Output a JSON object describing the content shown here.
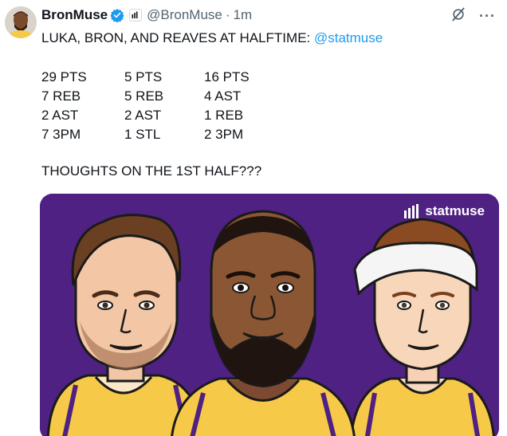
{
  "author": {
    "display_name": "BronMuse",
    "handle": "@BronMuse",
    "separator": "·",
    "time": "1m"
  },
  "tweet": {
    "text": "LUKA, BRON, AND REAVES AT HALFTIME: ",
    "mention": "@statmuse",
    "stats": [
      [
        "29 PTS",
        "5 PTS",
        "16 PTS"
      ],
      [
        "7 REB",
        "5 REB",
        "4 AST"
      ],
      [
        "2 AST",
        "2 AST",
        "1 REB"
      ],
      [
        "7 3PM",
        "1 STL",
        "2 3PM"
      ]
    ],
    "question": "THOUGHTS ON THE 1ST HALF???"
  },
  "media": {
    "brand": "statmuse",
    "background_color": "#4f2183",
    "jersey_color": "#f7c948"
  },
  "icons": {
    "verified": "verified-badge-icon",
    "affiliate": "statmuse-affiliate-icon",
    "grok": "grok-icon",
    "more": "more-icon"
  },
  "colors": {
    "text": "#0f1419",
    "secondary": "#536471",
    "link": "#1d9bf0",
    "verified": "#1d9bf0"
  }
}
